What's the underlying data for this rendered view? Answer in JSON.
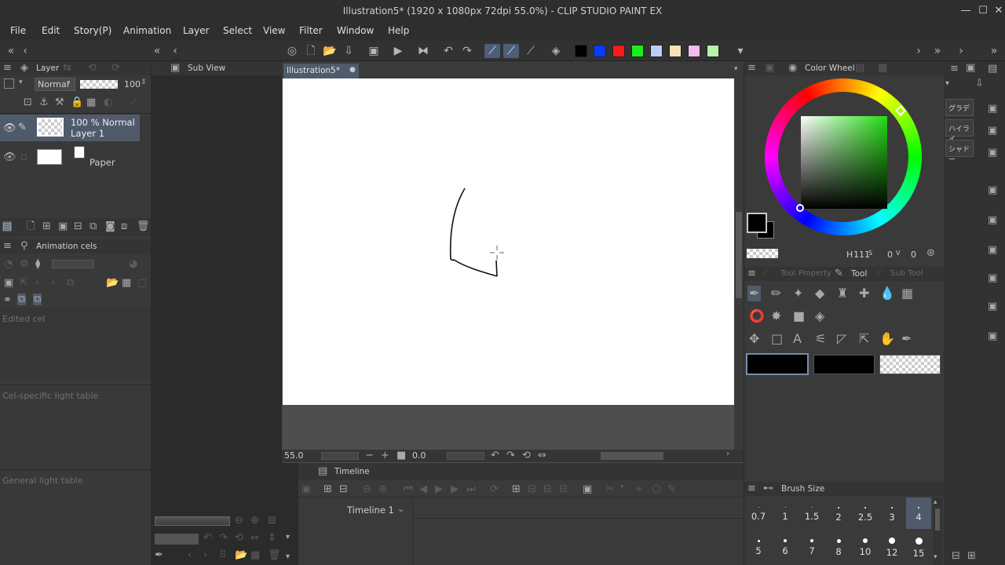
{
  "window": {
    "title": "Illustration5* (1920 x 1080px 72dpi 55.0%) - CLIP STUDIO PAINT EX"
  },
  "menu": [
    "File",
    "Edit",
    "Story(P)",
    "Animation",
    "Layer",
    "Select",
    "View",
    "Filter",
    "Window",
    "Help"
  ],
  "colors": {
    "swatches": [
      "#000000",
      "#0a3aff",
      "#ff1a1a",
      "#1aef1a",
      "#b9cdf7",
      "#f7e1b7",
      "#f4b9ee",
      "#b6f2a8"
    ],
    "main": "#000000",
    "sub": "#000000",
    "accent": "#4f5a6b"
  },
  "layer_panel": {
    "title": "Layer",
    "blend_mode": "Normal",
    "opacity": "100",
    "layers": [
      {
        "meta": "100 % Normal",
        "name": "Layer 1",
        "selected": true
      },
      {
        "meta": "",
        "name": "Paper",
        "selected": false
      }
    ]
  },
  "sub_view": {
    "title": "Sub View"
  },
  "animation_cels": {
    "title": "Animation cels",
    "edited_cel": "Edited cel",
    "cel_specific": "Cel-specific light table",
    "general": "General light table"
  },
  "document": {
    "tab_label": "Illustration5*",
    "zoom": "55.0",
    "rotation": "0.0"
  },
  "timeline": {
    "title": "Timeline",
    "track_name": "Timeline 1"
  },
  "color_wheel": {
    "title": "Color Wheel",
    "hsv": [
      "111",
      "0",
      "0"
    ],
    "hsv_prefix": "H"
  },
  "tool_panel": {
    "tabs": [
      "Tool Property",
      "Tool",
      "Sub Tool"
    ]
  },
  "brush_size": {
    "title": "Brush Size",
    "row1": [
      "0.7",
      "1",
      "1.5",
      "2",
      "2.5",
      "3",
      "4"
    ],
    "row2": [
      "5",
      "6",
      "7",
      "8",
      "10",
      "12",
      "15"
    ],
    "selected": "4"
  },
  "far_right": {
    "labels": [
      "グラデ",
      "ハイライ",
      "シャドー"
    ]
  }
}
